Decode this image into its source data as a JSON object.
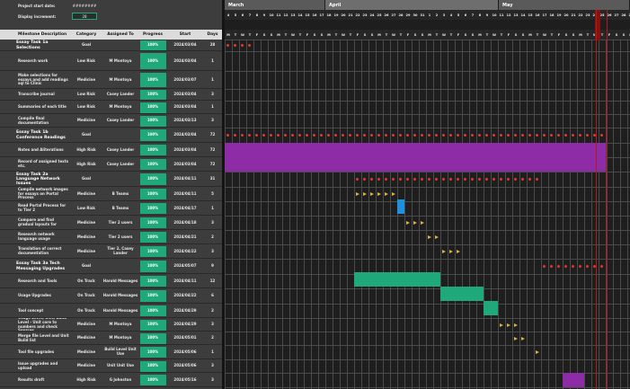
{
  "colors": {
    "panel": "#3d3d3d",
    "header": "#dcdcdc",
    "progress": "#1fa97a",
    "milestone": "#e23a2a",
    "flag": "#d9b24a",
    "purple": "#8e2ba6",
    "teal": "#1fa97a",
    "blue": "#1f8fe0",
    "today": "#b01c1c"
  },
  "info": {
    "start_label": "Project start date:",
    "start_value": "########",
    "inc_label": "Display increment:",
    "inc_value": "28"
  },
  "columns": [
    "Milestone Description",
    "Category",
    "Assigned To",
    "Progress",
    "Start",
    "Days"
  ],
  "months": [
    {
      "label": "March",
      "shade": "#5a5a5a"
    },
    {
      "label": "April",
      "shade": "#6e6e6e"
    },
    {
      "label": "May",
      "shade": "#5a5a5a"
    }
  ],
  "day_numbers": [
    4,
    5,
    6,
    7,
    8,
    9,
    10,
    11,
    12,
    13,
    14,
    15,
    16,
    17,
    18,
    19,
    20,
    21,
    22,
    23,
    24,
    25,
    26,
    27,
    28,
    29,
    30,
    31,
    1,
    2,
    3,
    4,
    5,
    6,
    7,
    8,
    9,
    10,
    11,
    12,
    13,
    14,
    15,
    16,
    17,
    18,
    19,
    20,
    21,
    22,
    23,
    24,
    25,
    26,
    27,
    28,
    29,
    30,
    1,
    2,
    3,
    4,
    5,
    6,
    7,
    8,
    9,
    10,
    11,
    12,
    13,
    14,
    15,
    16,
    17,
    18
  ],
  "day_letters": [
    "M",
    "T",
    "W",
    "T",
    "F",
    "S",
    "S"
  ],
  "rows": [
    {
      "desc": "Essay Task 1a Selections",
      "cat": "Goal",
      "asg": "",
      "prog": "100%",
      "start": "2024/03/04",
      "days": "28",
      "major": true
    },
    {
      "desc": "Research work",
      "cat": "Low Risk",
      "asg": "M Montoya",
      "prog": "100%",
      "start": "2024/03/04",
      "days": "1"
    },
    {
      "desc": "Make selections for essays and add readings sql to Clinic",
      "cat": "Medicine",
      "asg": "M Montoya",
      "prog": "100%",
      "start": "2024/03/07",
      "days": "1"
    },
    {
      "desc": "Transcribe journal",
      "cat": "Low Risk",
      "asg": "Casey Lander",
      "prog": "100%",
      "start": "2024/03/04",
      "days": "3"
    },
    {
      "desc": "Summaries of each title",
      "cat": "Low Risk",
      "asg": "M Montoya",
      "prog": "100%",
      "start": "2024/03/04",
      "days": "1"
    },
    {
      "desc": "Compile final documentation",
      "cat": "Medicine",
      "asg": "Casey Lander",
      "prog": "100%",
      "start": "2024/03/13",
      "days": "3"
    },
    {
      "desc": "Essay Task 1b Conference Readings",
      "cat": "Goal",
      "asg": "",
      "prog": "100%",
      "start": "2024/03/04",
      "days": "72",
      "major": true
    },
    {
      "desc": "Notes and Aliterations",
      "cat": "High Risk",
      "asg": "Casey Lander",
      "prog": "100%",
      "start": "2024/03/04",
      "days": "72"
    },
    {
      "desc": "Record of assigned texts etc.",
      "cat": "High Risk",
      "asg": "Casey Lander",
      "prog": "100%",
      "start": "2024/03/04",
      "days": "72"
    },
    {
      "desc": "Essay Task 2a Language Network Issues",
      "cat": "Goal",
      "asg": "",
      "prog": "100%",
      "start": "2024/04/11",
      "days": "31",
      "major": true
    },
    {
      "desc": "Compile network images for essays on Portal Process",
      "cat": "Medicine",
      "asg": "B Teams",
      "prog": "100%",
      "start": "2024/04/11",
      "days": "5"
    },
    {
      "desc": "Read Portal Process for to Tier 2",
      "cat": "Low Risk",
      "asg": "B Teams",
      "prog": "100%",
      "start": "2024/04/17",
      "days": "1"
    },
    {
      "desc": "Compare and find gradual layouts for",
      "cat": "Medicine",
      "asg": "Tier 2 users",
      "prog": "100%",
      "start": "2024/04/18",
      "days": "3"
    },
    {
      "desc": "Research network language usage",
      "cat": "Medicine",
      "asg": "Tier 2 users",
      "prog": "100%",
      "start": "2024/04/21",
      "days": "2"
    },
    {
      "desc": "Translation of correct documentation",
      "cat": "Medicine",
      "asg": "Tier 2, Casey Lander",
      "prog": "100%",
      "start": "2024/04/22",
      "days": "3"
    },
    {
      "desc": "Essay Task 3a Tech Messaging Upgrades",
      "cat": "Goal",
      "asg": "",
      "prog": "100%",
      "start": "2024/05/07",
      "days": "9",
      "major": true
    },
    {
      "desc": "Research and Tools",
      "cat": "On Track",
      "asg": "Harold Messages",
      "prog": "100%",
      "start": "2024/04/11",
      "days": "12"
    },
    {
      "desc": "Usage Upgrades",
      "cat": "On Track",
      "asg": "Harold Messages",
      "prog": "100%",
      "start": "2024/04/22",
      "days": "6"
    },
    {
      "desc": "Tool concept",
      "cat": "On Track",
      "asg": "Harold Messages",
      "prog": "100%",
      "start": "2024/04/29",
      "days": "2"
    },
    {
      "desc": "Usage Level, Unit, Build Level - Unit core to numbers and check Sources",
      "cat": "Medicine",
      "asg": "M Montoya",
      "prog": "100%",
      "start": "2024/04/29",
      "days": "3"
    },
    {
      "desc": "Merge file Level and Unit Build list",
      "cat": "Medicine",
      "asg": "M Montoya",
      "prog": "100%",
      "start": "2024/05/01",
      "days": "2"
    },
    {
      "desc": "Tool file upgrades",
      "cat": "Medicine",
      "asg": "Build Level Unit Use",
      "prog": "100%",
      "start": "2024/05/06",
      "days": "1"
    },
    {
      "desc": "Issue upgrades and upload",
      "cat": "Medicine",
      "asg": "Unit Unit Use",
      "prog": "100%",
      "start": "2024/05/06",
      "days": "3"
    },
    {
      "desc": "Results draft",
      "cat": "High Risk",
      "asg": "G Johnston",
      "prog": "100%",
      "start": "2024/05/16",
      "days": "3"
    }
  ]
}
